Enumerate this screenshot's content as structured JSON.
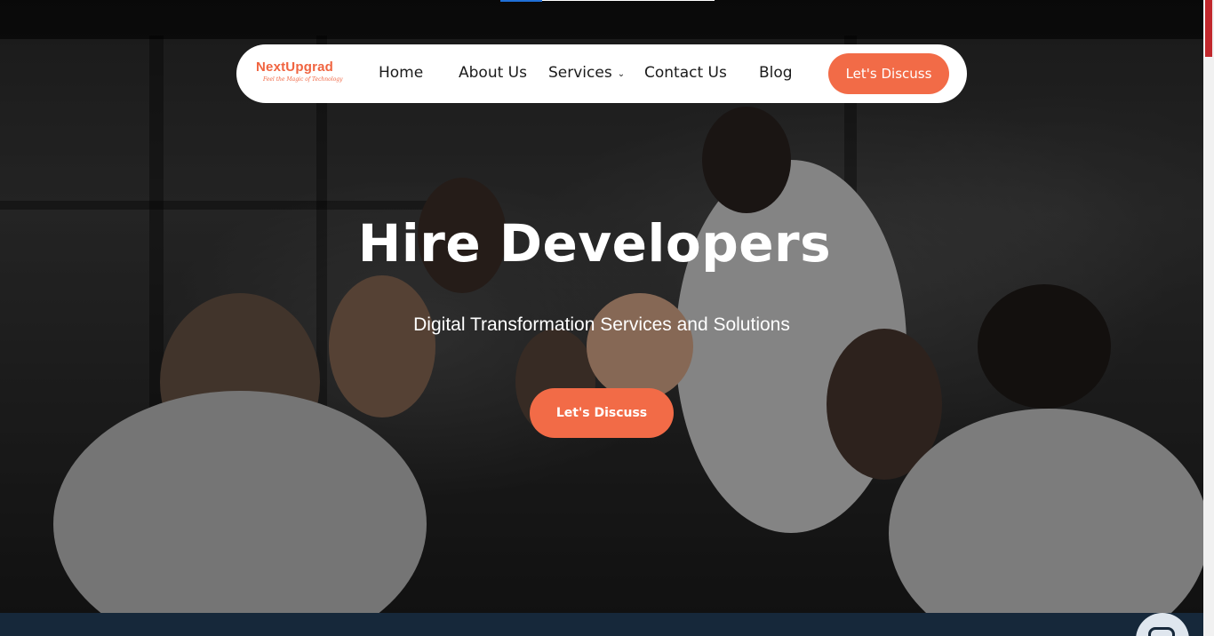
{
  "nav": {
    "logo_text": "NextUpgrad",
    "logo_tagline": "Feel the Magic of Technology",
    "items": [
      {
        "label": "Home"
      },
      {
        "label": "About Us"
      },
      {
        "label": "Services",
        "has_dropdown": true
      },
      {
        "label": "Contact Us"
      },
      {
        "label": "Blog"
      }
    ],
    "cta_label": "Let's Discuss"
  },
  "hero": {
    "title": "Hire Developers",
    "subtitle": "Digital Transformation Services and Solutions",
    "cta_label": "Let's Discuss"
  },
  "colors": {
    "accent": "#f26b47",
    "nav_bg": "#ffffff",
    "footer_strip": "#16283a",
    "scroll_thumb": "#c1282d"
  },
  "icons": {
    "dropdown": "chevron-down-icon",
    "chat": "chat-icon"
  }
}
